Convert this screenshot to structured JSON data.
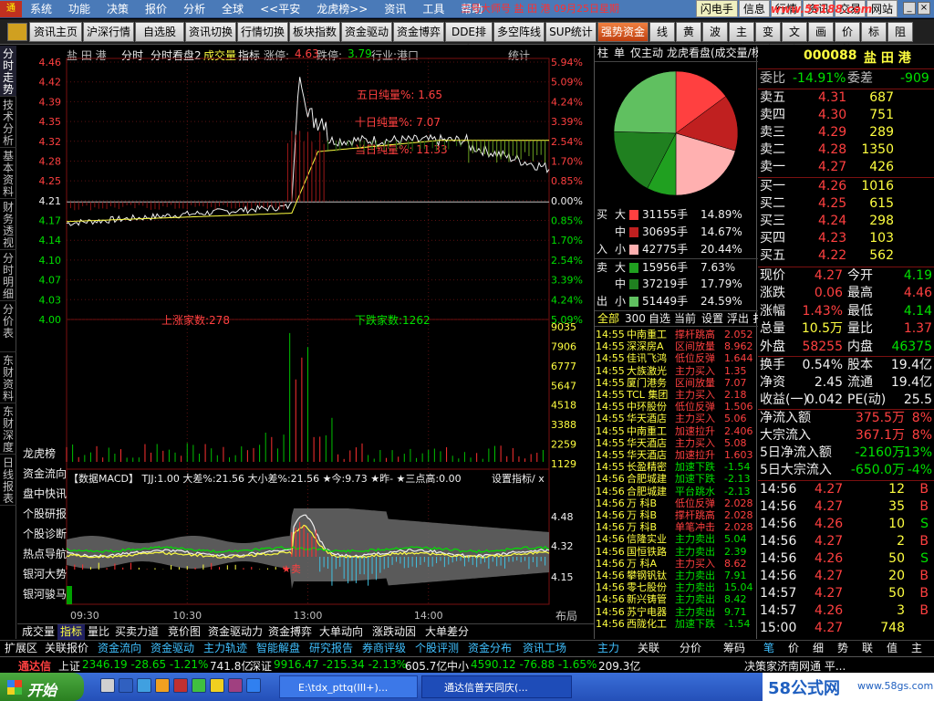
{
  "menubar": {
    "logo": "通",
    "items": [
      "系统",
      "功能",
      "决策",
      "报价",
      "分析",
      "全球",
      "<<平安",
      "龙虎榜>>",
      "资讯",
      "工具",
      "帮助"
    ],
    "ticker": "三号大师号 盐 田 港 09月25日星期",
    "right_items": [
      "闪电手",
      "信息",
      "行情",
      "资讯",
      "交易",
      "网站"
    ],
    "watermark": "www.55188.com"
  },
  "toolbar": {
    "items": [
      "资讯主页",
      "沪深行情",
      "自选股",
      "资讯切换",
      "行情切换",
      "板块指数",
      "资金驱动",
      "资金博弈",
      "DDE排名",
      "多空阵线",
      "SUP统计",
      "强势资金",
      "线段",
      "黄金",
      "波段",
      "主力",
      "变波",
      "文字",
      "画图",
      "价格",
      "标价",
      "阻速"
    ]
  },
  "vtabs": [
    "分时走势",
    "技术分析",
    "基本资料",
    "财务透视",
    "分时明细",
    "分价表",
    "东财资料",
    "东财深度",
    "日线报表"
  ],
  "chart": {
    "header": {
      "name": "盐 田 港",
      "mode": "分时",
      "view": "分时看盘2",
      "vol_label": "成交量",
      "indicator": "指标",
      "rise_label": "涨停:",
      "rise_val": "4.63",
      "fall_label": "跌停:",
      "fall_val": "3.79",
      "industry": "行业:港口",
      "stats": "统计"
    },
    "price_labels": [
      "4.46",
      "4.42",
      "4.39",
      "4.35",
      "4.32",
      "4.28",
      "4.25",
      "4.21",
      "4.17",
      "4.14",
      "4.10",
      "4.07",
      "4.03",
      "4.00"
    ],
    "pct_labels": [
      "5.94%",
      "5.09%",
      "4.24%",
      "3.39%",
      "2.54%",
      "1.70%",
      "0.85%",
      "0.00%",
      "0.85%",
      "1.70%",
      "2.54%",
      "3.39%",
      "4.24%",
      "5.09%"
    ],
    "annotations": [
      "五日纯量%: 1.65",
      "十日纯量%: 7.07",
      "当日纯量%: 11.33"
    ],
    "up_count": "上涨家数:278",
    "down_count": "下跌家数:1262",
    "vol_labels": [
      "9035",
      "7906",
      "6777",
      "5647",
      "4518",
      "3388",
      "2259",
      "1129"
    ],
    "macd_header": "【数据MACD】  TJJ:1.00  大差%:21.56  大小差%:21.56  ★今:9.73  ★昨-  ★三点高:0.00",
    "macd_overlay": "设置指标/ x",
    "macd_prices": [
      "4.48",
      "4.32",
      "4.15"
    ],
    "times": [
      "09:30",
      "10:30",
      "13:00",
      "14:00"
    ],
    "layout_btn": "布局",
    "side_menu": [
      "龙虎榜",
      "资金流向",
      "盘中快讯",
      "个股研报",
      "个股诊断",
      "热点导航",
      "银河大势",
      "银河骏马"
    ],
    "sell_label": "★卖"
  },
  "mid_panel": {
    "tabs": [
      "柱",
      "单",
      "仅主动",
      "龙虎看盘(成交量/杨"
    ],
    "flow_rows": [
      {
        "side": "买",
        "size": "大",
        "amount": "31155手",
        "pct": "14.89%",
        "color": "#ff4040"
      },
      {
        "side": "",
        "size": "中",
        "amount": "30695手",
        "pct": "14.67%",
        "color": "#c02020"
      },
      {
        "side": "入",
        "size": "小",
        "amount": "42775手",
        "pct": "20.44%",
        "color": "#ffb0b0"
      },
      {
        "side": "卖",
        "size": "大",
        "amount": "15956手",
        "pct": "7.63%",
        "color": "#20a020"
      },
      {
        "side": "",
        "size": "中",
        "amount": "37219手",
        "pct": "17.79%",
        "color": "#208020"
      },
      {
        "side": "出",
        "size": "小",
        "amount": "51449手",
        "pct": "24.59%",
        "color": "#60c060"
      }
    ],
    "list_tabs": [
      "全部",
      "300",
      "自选",
      "当前",
      "设置",
      "浮出",
      "扌"
    ],
    "list": [
      {
        "time": "14:55",
        "name": "中南重工",
        "event": "撑杆跳高",
        "val": "2.052"
      },
      {
        "time": "14:55",
        "name": "深深房A",
        "event": "区间放量",
        "val": "8.962"
      },
      {
        "time": "14:55",
        "name": "佳讯飞鸿",
        "event": "低位反弹",
        "val": "1.644"
      },
      {
        "time": "14:55",
        "name": "大族激光",
        "event": "主力买入",
        "val": "1.35"
      },
      {
        "time": "14:55",
        "name": "厦门港务",
        "event": "区间放量",
        "val": "7.07"
      },
      {
        "time": "14:55",
        "name": "TCL 集团",
        "event": "主力买入",
        "val": "2.18"
      },
      {
        "time": "14:55",
        "name": "中环股份",
        "event": "低位反弹",
        "val": "1.506"
      },
      {
        "time": "14:55",
        "name": "华天酒店",
        "event": "主力买入",
        "val": "5.06"
      },
      {
        "time": "14:55",
        "name": "中南重工",
        "event": "加速拉升",
        "val": "2.406"
      },
      {
        "time": "14:55",
        "name": "华天酒店",
        "event": "主力买入",
        "val": "5.08"
      },
      {
        "time": "14:55",
        "name": "华天酒店",
        "event": "加速拉升",
        "val": "1.603"
      },
      {
        "time": "14:55",
        "name": "长盈精密",
        "event": "加速下跌",
        "val": "-1.54"
      },
      {
        "time": "14:56",
        "name": "合肥城建",
        "event": "加速下跌",
        "val": "-2.13"
      },
      {
        "time": "14:56",
        "name": "合肥城建",
        "event": "平台跳水",
        "val": "-2.13"
      },
      {
        "time": "14:56",
        "name": "万  科B",
        "event": "低位反弹",
        "val": "2.028"
      },
      {
        "time": "14:56",
        "name": "万  科B",
        "event": "撑杆跳高",
        "val": "2.028"
      },
      {
        "time": "14:56",
        "name": "万  科B",
        "event": "单笔冲击",
        "val": "2.028"
      },
      {
        "time": "14:56",
        "name": "信隆实业",
        "event": "主力卖出",
        "val": "5.04"
      },
      {
        "time": "14:56",
        "name": "国恒铁路",
        "event": "主力卖出",
        "val": "2.39"
      },
      {
        "time": "14:56",
        "name": "万  科A",
        "event": "主力买入",
        "val": "8.62"
      },
      {
        "time": "14:56",
        "name": "攀钢钒钛",
        "event": "主力卖出",
        "val": "7.91"
      },
      {
        "time": "14:56",
        "name": "零七股份",
        "event": "主力卖出",
        "val": "15.04"
      },
      {
        "time": "14:56",
        "name": "新兴铸管",
        "event": "主力卖出",
        "val": "8.42"
      },
      {
        "time": "14:56",
        "name": "苏宁电器",
        "event": "主力卖出",
        "val": "9.71"
      },
      {
        "time": "14:56",
        "name": "西陇化工",
        "event": "加速下跌",
        "val": "-1.54"
      }
    ],
    "bottom_tabs": [
      "主力",
      "关联",
      "分价",
      "筹码"
    ]
  },
  "quote": {
    "code": "000088",
    "name": "盐 田 港",
    "webi_label": "委比",
    "webi_val": "-14.91%",
    "wecha_label": "委差",
    "wecha_val": "-909",
    "asks": [
      {
        "label": "卖五",
        "price": "4.31",
        "vol": "687"
      },
      {
        "label": "卖四",
        "price": "4.30",
        "vol": "751"
      },
      {
        "label": "卖三",
        "price": "4.29",
        "vol": "289"
      },
      {
        "label": "卖二",
        "price": "4.28",
        "vol": "1350"
      },
      {
        "label": "卖一",
        "price": "4.27",
        "vol": "426"
      }
    ],
    "bids": [
      {
        "label": "买一",
        "price": "4.26",
        "vol": "1016"
      },
      {
        "label": "买二",
        "price": "4.25",
        "vol": "615"
      },
      {
        "label": "买三",
        "price": "4.24",
        "vol": "298"
      },
      {
        "label": "买四",
        "price": "4.23",
        "vol": "103"
      },
      {
        "label": "买五",
        "price": "4.22",
        "vol": "562"
      }
    ],
    "stats": [
      {
        "l1": "现价",
        "v1": "4.27",
        "c1": "#ff4040",
        "l2": "今开",
        "v2": "4.19",
        "c2": "#00e000"
      },
      {
        "l1": "涨跌",
        "v1": "0.06",
        "c1": "#ff4040",
        "l2": "最高",
        "v2": "4.46",
        "c2": "#ff4040"
      },
      {
        "l1": "涨幅",
        "v1": "1.43%",
        "c1": "#ff4040",
        "l2": "最低",
        "v2": "4.14",
        "c2": "#00e000"
      },
      {
        "l1": "总量",
        "v1": "10.5万",
        "c1": "#ffff40",
        "l2": "量比",
        "v2": "1.37",
        "c2": "#ff4040"
      },
      {
        "l1": "外盘",
        "v1": "58255",
        "c1": "#ff4040",
        "l2": "内盘",
        "v2": "46375",
        "c2": "#00e000"
      }
    ],
    "stats2": [
      {
        "l1": "换手",
        "v1": "0.54%",
        "l2": "股本",
        "v2": "19.4亿"
      },
      {
        "l1": "净资",
        "v1": "2.45",
        "l2": "流通",
        "v2": "19.4亿"
      },
      {
        "l1": "收益(一)",
        "v1": "0.042",
        "l2": "PE(动)",
        "v2": "25.5"
      }
    ],
    "flows": [
      {
        "label": "净流入额",
        "val": "375.5万",
        "pct": "8%",
        "color": "#ff4040"
      },
      {
        "label": "大宗流入",
        "val": "367.1万",
        "pct": "8%",
        "color": "#ff4040"
      },
      {
        "label": "5日净流入额",
        "val": "-2160万",
        "pct": "-13%",
        "color": "#00e000"
      },
      {
        "label": "5日大宗流入",
        "val": "-650.0万",
        "pct": "-4%",
        "color": "#00e000"
      }
    ],
    "ticks": [
      {
        "t": "14:56",
        "p": "4.27",
        "v": "12",
        "bs": "B",
        "pc": "#ff4040",
        "bc": "#ff4040"
      },
      {
        "t": "14:56",
        "p": "4.27",
        "v": "35",
        "bs": "B",
        "pc": "#ff4040",
        "bc": "#ff4040"
      },
      {
        "t": "14:56",
        "p": "4.26",
        "v": "10",
        "bs": "S",
        "pc": "#ff4040",
        "bc": "#00e000"
      },
      {
        "t": "14:56",
        "p": "4.27",
        "v": "2",
        "bs": "B",
        "pc": "#ff4040",
        "bc": "#ff4040"
      },
      {
        "t": "14:56",
        "p": "4.26",
        "v": "50",
        "bs": "S",
        "pc": "#ff4040",
        "bc": "#00e000"
      },
      {
        "t": "14:56",
        "p": "4.27",
        "v": "20",
        "bs": "B",
        "pc": "#ff4040",
        "bc": "#ff4040"
      },
      {
        "t": "14:57",
        "p": "4.27",
        "v": "50",
        "bs": "B",
        "pc": "#ff4040",
        "bc": "#ff4040"
      },
      {
        "t": "14:57",
        "p": "4.26",
        "v": "3",
        "bs": "B",
        "pc": "#ff4040",
        "bc": "#ff4040"
      },
      {
        "t": "15:00",
        "p": "4.27",
        "v": "748",
        "bs": "",
        "pc": "#ff4040",
        "bc": "#ff4040"
      }
    ],
    "bottom_tabs": [
      "笔",
      "价",
      "细",
      "势",
      "联",
      "值",
      "主"
    ]
  },
  "bottom_tabs1": [
    "成交量",
    "指标",
    "量比",
    "买卖力道",
    "竞价图",
    "资金驱动力",
    "资金搏弈",
    "大单动向",
    "涨跌动因",
    "大单差分"
  ],
  "bottom_tabs2": [
    "扩展区",
    "关联报价",
    "资金流向",
    "资金驱动",
    "主力轨迹",
    "智能解盘",
    "研究报告",
    "券商评级",
    "个股评测",
    "资金分布",
    "资讯工场"
  ],
  "status": {
    "app": "通达信",
    "sh_label": "上证",
    "sh": "2346.19  -28.65  -1.21%",
    "sh_amt": "741.8亿",
    "sz_label": "深证",
    "sz": "9916.47  -215.34  -2.13%",
    "sz_amt": "605.7亿",
    "zx_label": "中小",
    "zx": "4590.12  -76.88  -1.65%",
    "zx_amt": "209.3亿",
    "right": "决策家济南网通  平..."
  },
  "taskbar": {
    "start": "开始",
    "win1": "E:\\tdx_pttq(III+)...",
    "win2": "通达信普天同庆(...",
    "brand": "58公式网",
    "brand_url": "www.58gs.com"
  },
  "chart_data": [
    {
      "type": "line",
      "title": "盐 田 港",
      "x": [
        "09:30",
        "10:30",
        "13:00",
        "14:00",
        "15:00"
      ],
      "series": [
        {
          "values": [
            4.17,
            4.19,
            4.21,
            4.33,
            4.27
          ]
        }
      ],
      "ylim": [
        4.0,
        4.46
      ]
    },
    {
      "type": "pie",
      "categories": [
        "买大",
        "买中",
        "买小",
        "卖大",
        "卖中",
        "卖小"
      ],
      "values": [
        14.89,
        14.67,
        20.44,
        7.63,
        17.79,
        24.59
      ]
    }
  ]
}
